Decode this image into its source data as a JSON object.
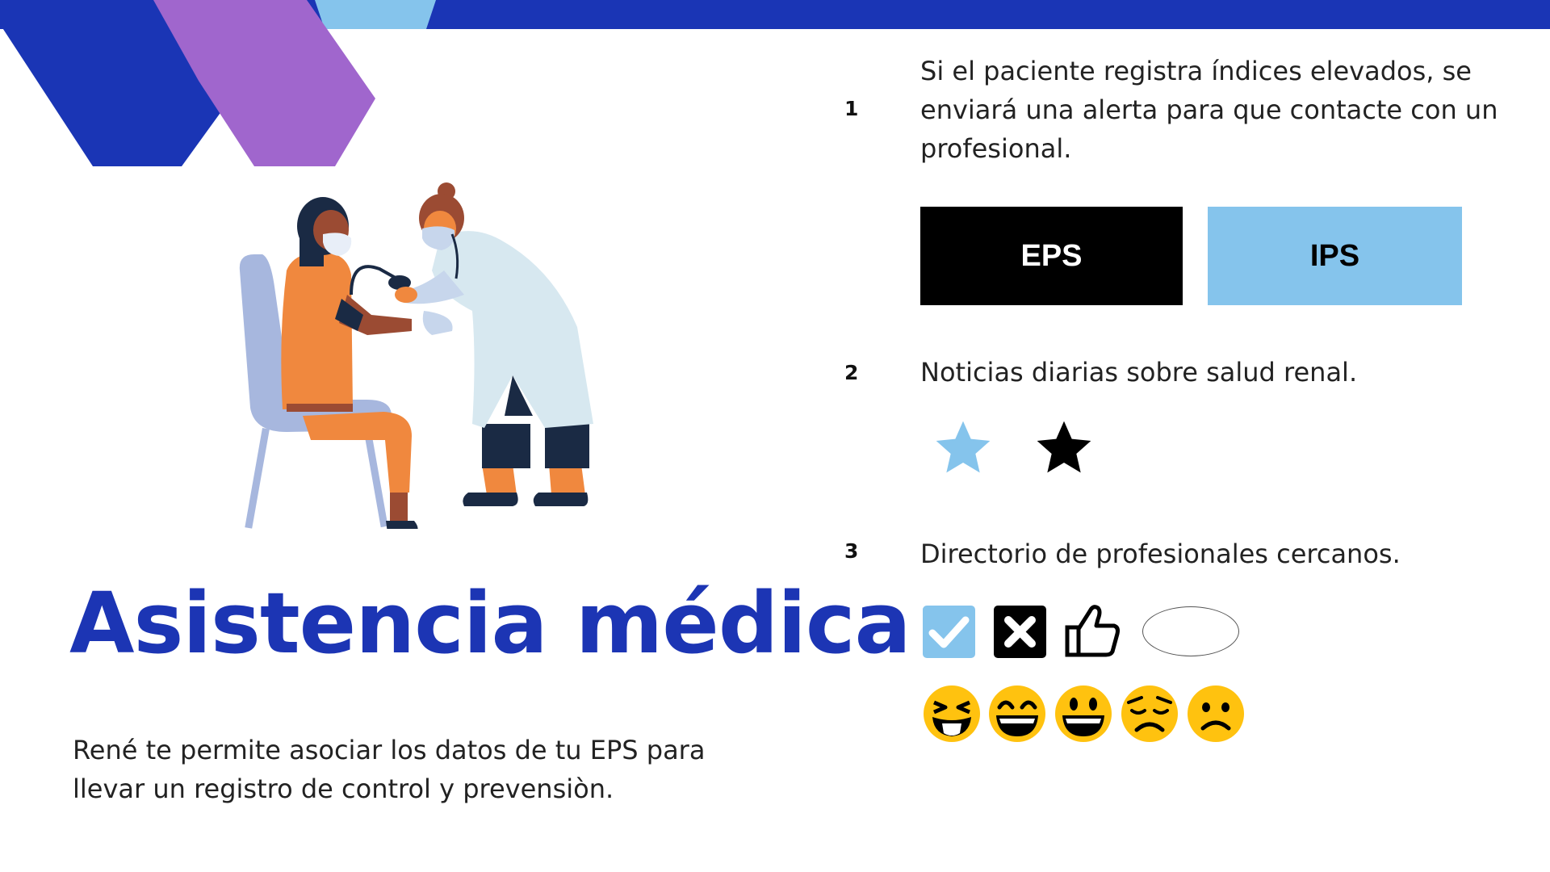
{
  "slide": {
    "title": "Asistencia médica",
    "description": "René te permite asociar los datos de tu EPS para llevar un registro de control y prevensiòn."
  },
  "items": [
    {
      "number": "1",
      "text": "Si el paciente registra índices elevados, se enviará una alerta para que contacte con un profesional."
    },
    {
      "number": "2",
      "text": "Noticias diarias sobre salud renal."
    },
    {
      "number": "3",
      "text": "Directorio de profesionales cercanos."
    }
  ],
  "buttons": {
    "eps": "EPS",
    "ips": "IPS"
  },
  "icons": {
    "stars": [
      "star-light-blue-icon",
      "star-black-icon"
    ],
    "controls": [
      "checkbox-checked-icon",
      "close-box-icon",
      "thumbs-up-icon",
      "ellipse-shape"
    ],
    "emojis": [
      "tongue-wink-emoji",
      "grin-emoji",
      "smile-emoji",
      "sad-emoji",
      "frown-emoji"
    ]
  },
  "colors": {
    "primary_blue": "#1a35b5",
    "purple": "#a066cd",
    "light_blue": "#85c4ec",
    "black": "#000000",
    "emoji_yellow": "#ffc20f"
  }
}
